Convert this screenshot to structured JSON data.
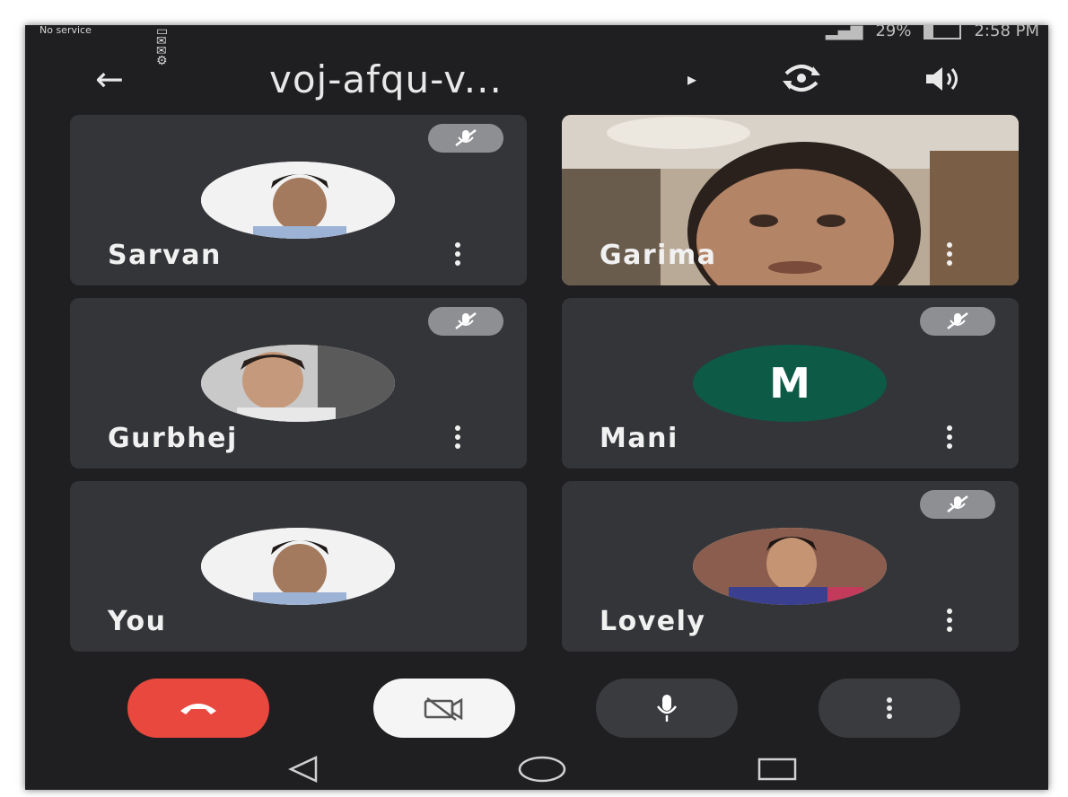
{
  "status_bar": {
    "carrier": "No service",
    "battery": "29%",
    "time": "2:58 PM"
  },
  "header": {
    "meeting_code": "voj-afqu-v...",
    "back_icon": "back-arrow-icon",
    "switch_camera_icon": "switch-camera-icon",
    "audio_output_icon": "speaker-icon"
  },
  "participants": [
    {
      "name": "Sarvan",
      "muted": true,
      "display": "photo"
    },
    {
      "name": "Garima",
      "muted": false,
      "display": "video"
    },
    {
      "name": "Gurbhej",
      "muted": true,
      "display": "photo"
    },
    {
      "name": "Mani",
      "muted": true,
      "display": "initial",
      "initial": "M",
      "avatar_color": "#0d5a46"
    },
    {
      "name": "You",
      "muted": false,
      "display": "photo"
    },
    {
      "name": "Lovely",
      "muted": true,
      "display": "photo"
    }
  ],
  "controls": {
    "end_call_color": "#e8483e",
    "camera_state": "off",
    "mic_state": "on"
  },
  "colors": {
    "background": "#1f1f21",
    "tile": "#343538",
    "mute_badge": "#8e8f92"
  }
}
